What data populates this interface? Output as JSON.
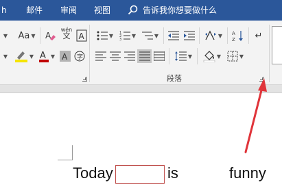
{
  "menu": {
    "partial_left": "h",
    "mailings": "邮件",
    "review": "审阅",
    "view": "视图",
    "tell_me": "告诉我你想要做什么"
  },
  "font_group": {
    "font_size_label": "Aa",
    "phonetic_label": "wén",
    "phonetic_sub": "文"
  },
  "paragraph_group": {
    "label": "段落",
    "highlight_color": "#f5e400",
    "font_color": "#c00000"
  },
  "document": {
    "word1": "Today",
    "word2": "is",
    "word3": "funny"
  },
  "colors": {
    "menubar": "#2b579a",
    "annotation_arrow": "#e0343a",
    "blank_box_border": "#c0504d"
  }
}
